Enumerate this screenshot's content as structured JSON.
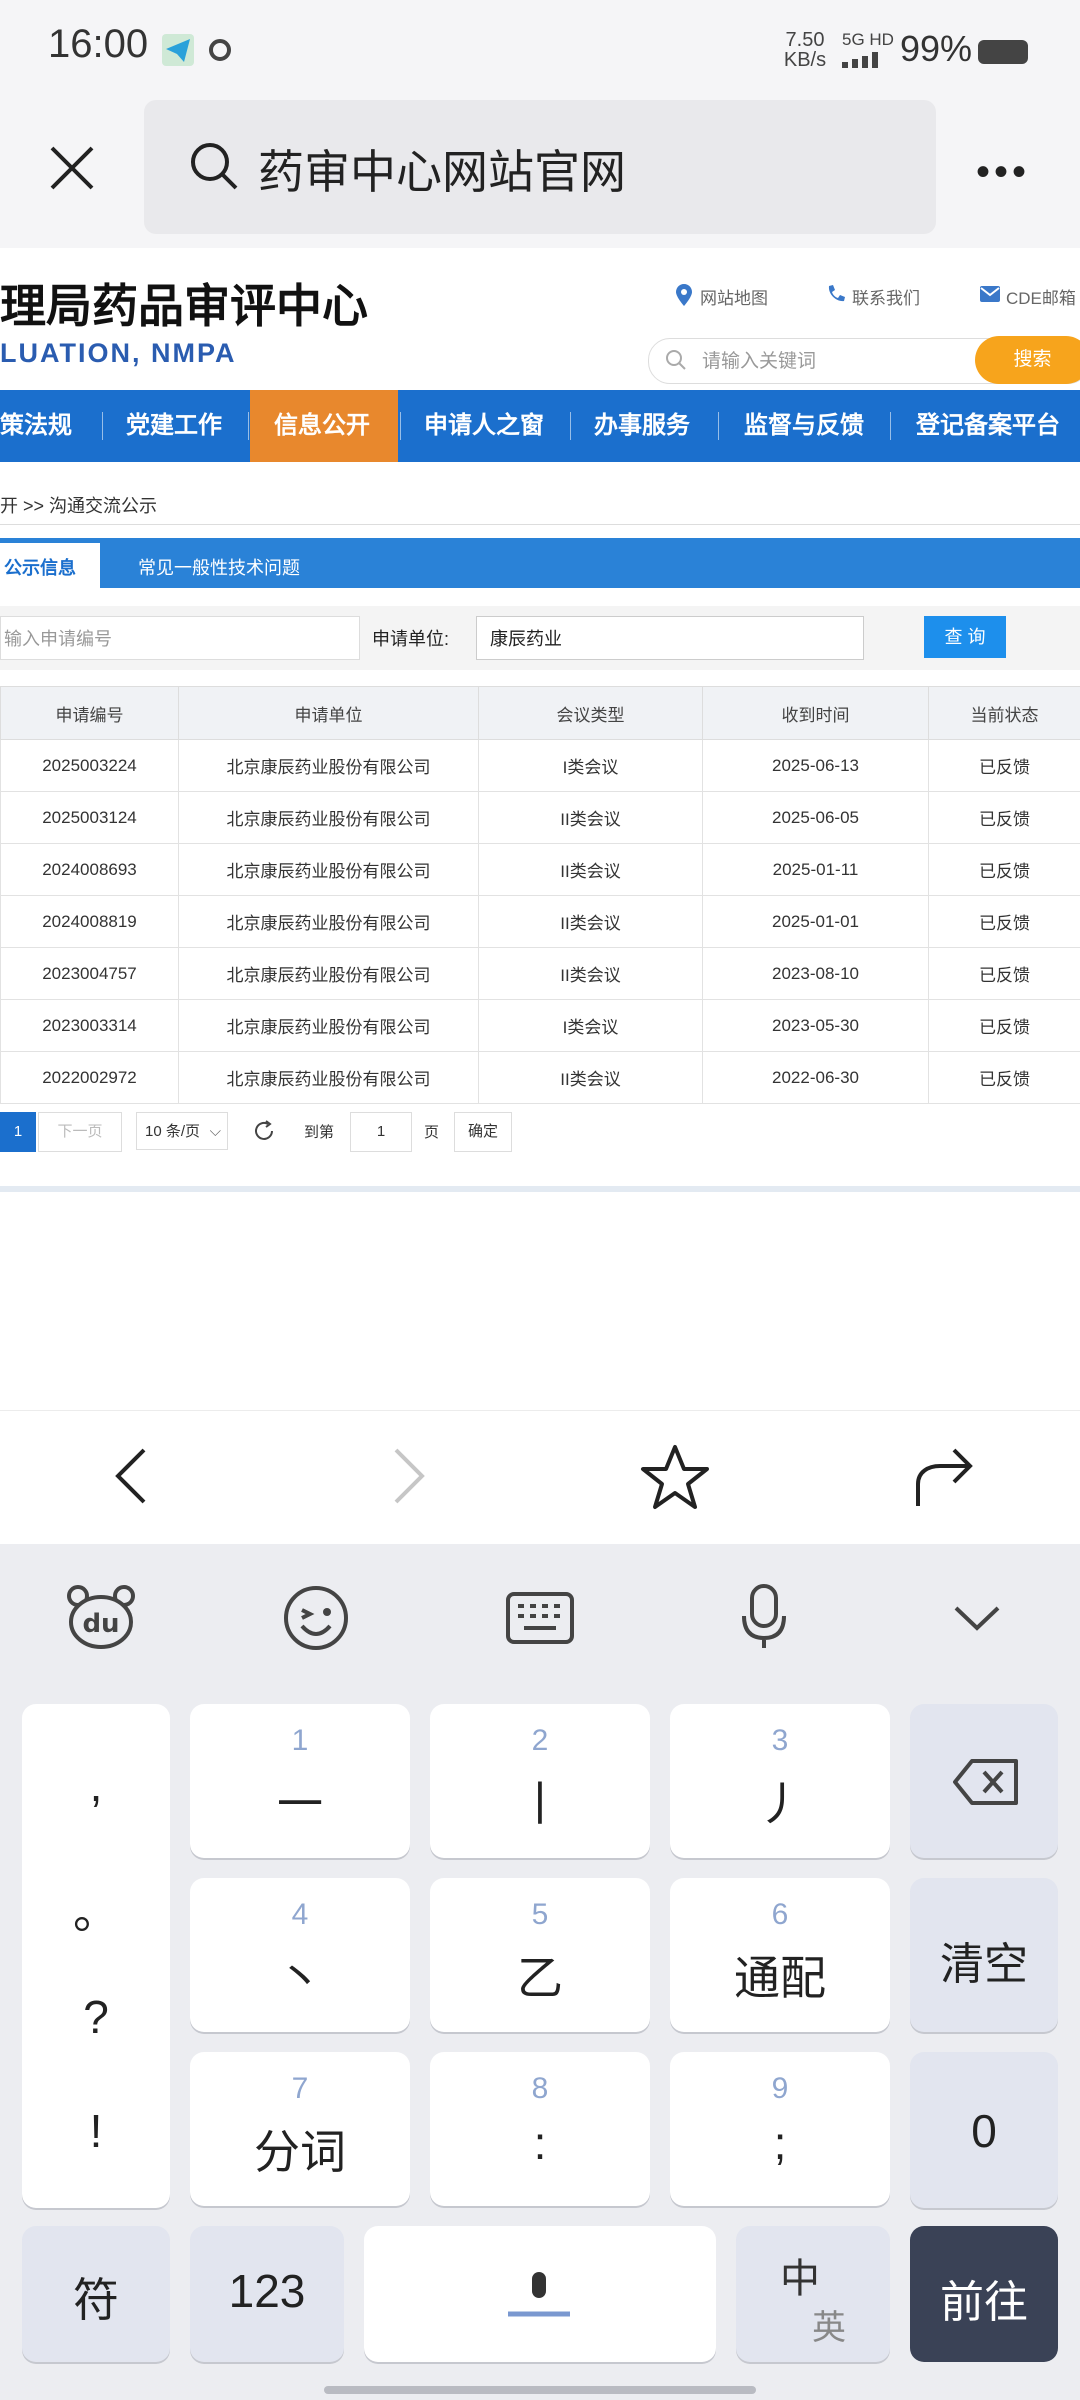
{
  "status_bar": {
    "time": "16:00",
    "net_speed_top": "7.50",
    "net_speed_bottom": "KB/s",
    "signal": "5G HD",
    "battery": "99%"
  },
  "browser": {
    "url_text": "药审中心网站官网",
    "more_label": "•••"
  },
  "site": {
    "title": "理局药品审评中心",
    "subtitle": "LUATION, NMPA",
    "top_links": [
      "网站地图",
      "联系我们",
      "CDE邮箱"
    ],
    "search_placeholder": "请输入关键词",
    "search_button": "搜索",
    "nav": [
      "策法规",
      "党建工作",
      "信息公开",
      "申请人之窗",
      "办事服务",
      "监督与反馈",
      "登记备案平台"
    ],
    "breadcrumb": "开 >> 沟通交流公示",
    "tabs": [
      "公示信息",
      "常见一般性技术问题"
    ],
    "filter": {
      "no_placeholder": "输入申请编号",
      "unit_label": "申请单位:",
      "unit_value": "康辰药业",
      "query_button": "查 询"
    },
    "table": {
      "headers": [
        "申请编号",
        "申请单位",
        "会议类型",
        "收到时间",
        "当前状态"
      ],
      "rows": [
        [
          "2025003224",
          "北京康辰药业股份有限公司",
          "I类会议",
          "2025-06-13",
          "已反馈"
        ],
        [
          "2025003124",
          "北京康辰药业股份有限公司",
          "II类会议",
          "2025-06-05",
          "已反馈"
        ],
        [
          "2024008693",
          "北京康辰药业股份有限公司",
          "II类会议",
          "2025-01-11",
          "已反馈"
        ],
        [
          "2024008819",
          "北京康辰药业股份有限公司",
          "II类会议",
          "2025-01-01",
          "已反馈"
        ],
        [
          "2023004757",
          "北京康辰药业股份有限公司",
          "II类会议",
          "2023-08-10",
          "已反馈"
        ],
        [
          "2023003314",
          "北京康辰药业股份有限公司",
          "I类会议",
          "2023-05-30",
          "已反馈"
        ],
        [
          "2022002972",
          "北京康辰药业股份有限公司",
          "II类会议",
          "2022-06-30",
          "已反馈"
        ]
      ]
    },
    "pager": {
      "current": "1",
      "next": "下一页",
      "page_size": "10 条/页",
      "goto_label": "到第",
      "goto_value": "1",
      "page_unit": "页",
      "confirm": "确定"
    }
  },
  "keyboard": {
    "top_icons": [
      "du-bear-icon",
      "emoji-icon",
      "keyboard-icon",
      "mic-icon",
      "collapse-icon"
    ],
    "punct": [
      ",",
      "。",
      "?",
      "!"
    ],
    "keys": [
      {
        "num": "1",
        "label": "一"
      },
      {
        "num": "2",
        "label": "丨"
      },
      {
        "num": "3",
        "label": "丿"
      },
      {
        "num": "4",
        "label": "丶"
      },
      {
        "num": "5",
        "label": "乙"
      },
      {
        "num": "6",
        "label": "通配"
      },
      {
        "num": "7",
        "label": "分词"
      },
      {
        "num": "8",
        "label": ":"
      },
      {
        "num": "9",
        "label": ";"
      }
    ],
    "clear": "清空",
    "zero": "0",
    "symbols": "符",
    "numeric": "123",
    "lang_top": "中",
    "lang_bottom": "英",
    "go": "前往"
  },
  "colors": {
    "nav_blue": "#1b6fcd",
    "nav_active": "#e8882d",
    "search_orange": "#f7a41c",
    "go_key": "#3a4256"
  }
}
